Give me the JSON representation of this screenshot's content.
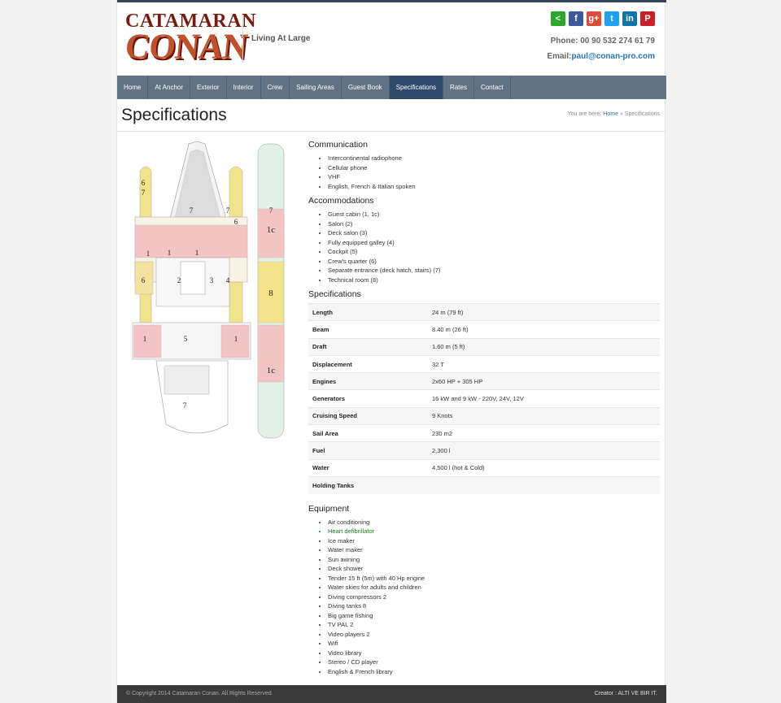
{
  "brand": {
    "line1": "CATAMARAN",
    "line2": "CONAN",
    "tagline": "Living At Large"
  },
  "social": [
    {
      "icon": "share-icon",
      "glyph": "<",
      "color": "#2ba82b"
    },
    {
      "icon": "facebook-icon",
      "glyph": "f",
      "color": "#3b5998"
    },
    {
      "icon": "google-plus-icon",
      "glyph": "g+",
      "color": "#dd4b39"
    },
    {
      "icon": "twitter-icon",
      "glyph": "t",
      "color": "#1da1f2"
    },
    {
      "icon": "linkedin-icon",
      "glyph": "in",
      "color": "#0e76a8"
    },
    {
      "icon": "pinterest-icon",
      "glyph": "P",
      "color": "#cb2027"
    }
  ],
  "contact": {
    "phone": "Phone: 00 90 532 274 61 79",
    "email_label": "Email:",
    "email": "paul@conan-pro.com"
  },
  "nav": [
    "Home",
    "At Anchor",
    "Exterior",
    "Interior",
    "Crew",
    "Sailing Areas",
    "Guest Book",
    "Specifications",
    "Rates",
    "Contact"
  ],
  "nav_active": "Specifications",
  "page": {
    "title": "Specifications"
  },
  "breadcrumb": {
    "prefix": "You are here:",
    "home": "Home",
    "sep": "»",
    "current": "Specifications"
  },
  "plan": {
    "labels": [
      "6",
      "7",
      "7",
      "7",
      "6",
      "1",
      "1",
      "1",
      "2",
      "3",
      "4",
      "6",
      "1",
      "5",
      "1",
      "7",
      "1c",
      "8",
      "1c",
      "7"
    ]
  },
  "sections": {
    "communication": {
      "title": "Communication",
      "items": [
        "Intercontinental radiophone",
        "Cellular phone",
        "VHF",
        "English, French & Italian spoken"
      ]
    },
    "accommodations": {
      "title": "Accommodations",
      "items": [
        "Guest cabin (1, 1c)",
        "Salon (2)",
        "Deck salon (3)",
        "Fully equipped galley (4)",
        "Cockpit (5)",
        "Crew's quarter (6)",
        "Separate entrance (deck hatch, stairs) (7)",
        "Technical room (8)"
      ]
    },
    "specifications": {
      "title": "Specifications",
      "rows": [
        [
          "Length",
          "24 m (79 ft)"
        ],
        [
          "Beam",
          "8.40 m (26 ft)"
        ],
        [
          "Draft",
          "1.60 m (5 ft)"
        ],
        [
          "Displacement",
          "32 T"
        ],
        [
          "Engines",
          "2x60 HP + 305 HP"
        ],
        [
          "Generators",
          "16 kW and 9 kW - 220V, 24V, 12V"
        ],
        [
          "Cruising Speed",
          "9 Knots"
        ],
        [
          "Sail Area",
          "230 m2"
        ],
        [
          "Fuel",
          "2,300 l"
        ],
        [
          "Water",
          "4,500 l (hot & Cold)"
        ],
        [
          "Holding Tanks",
          ""
        ]
      ]
    },
    "equipment": {
      "title": "Equipment",
      "items": [
        "Air conditioning",
        "Heart defibrillator",
        "Ice maker",
        "Water maker",
        "Sun awning",
        "Deck shower",
        "Tender 15 ft (5m) with 40 Hp engine",
        "Water skies for adults and children",
        "Diving compressors 2",
        "Diving tanks 8",
        "Big game fishing",
        "TV PAL 2",
        "Video players 2",
        "Wifi",
        "Video library",
        "Stereo / CD player",
        "English & French library"
      ],
      "highlight": "Heart defibrillator"
    }
  },
  "footer": {
    "copyright": "© Copyright 2014 Catamaran Conan. All Rights Reserved.",
    "creator": "Creator : ALTI VE BIR IT."
  }
}
